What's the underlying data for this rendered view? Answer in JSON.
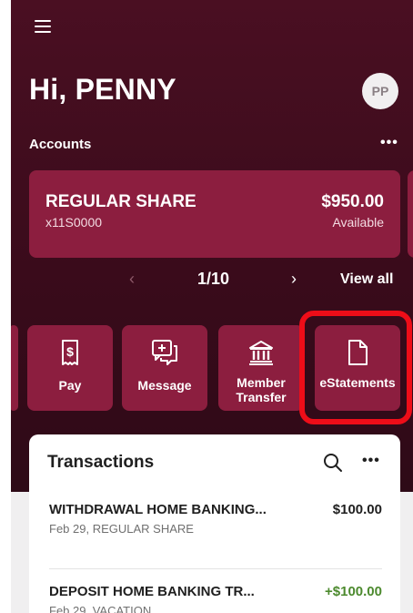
{
  "header": {
    "greeting": "Hi, PENNY",
    "avatar_initials": "PP"
  },
  "accounts": {
    "label": "Accounts",
    "more": "•••",
    "card": {
      "name": "REGULAR SHARE",
      "number": "x11S0000",
      "balance": "$950.00",
      "balance_label": "Available"
    },
    "pager": {
      "prev": "‹",
      "count": "1/10",
      "next": "›",
      "view_all": "View all"
    }
  },
  "actions": [
    {
      "label": "Pay",
      "icon": "receipt-dollar-icon"
    },
    {
      "label": "Message",
      "icon": "chat-plus-icon"
    },
    {
      "label": "Member Transfer",
      "icon": "bank-icon"
    },
    {
      "label": "eStatements",
      "icon": "document-icon"
    }
  ],
  "transactions": {
    "title": "Transactions",
    "more": "•••",
    "items": [
      {
        "description": "WITHDRAWAL HOME BANKING...",
        "amount": "$100.00",
        "detail": "Feb 29, REGULAR SHARE"
      },
      {
        "description": "DEPOSIT HOME BANKING TR...",
        "amount": "+$100.00",
        "detail": "Feb 29, VACATION"
      }
    ]
  },
  "colors": {
    "hero_bg": "#3a0b1b",
    "tile_bg": "#8c1e3f",
    "highlight": "#ee0d18",
    "positive_amount": "#4c8a2e"
  }
}
